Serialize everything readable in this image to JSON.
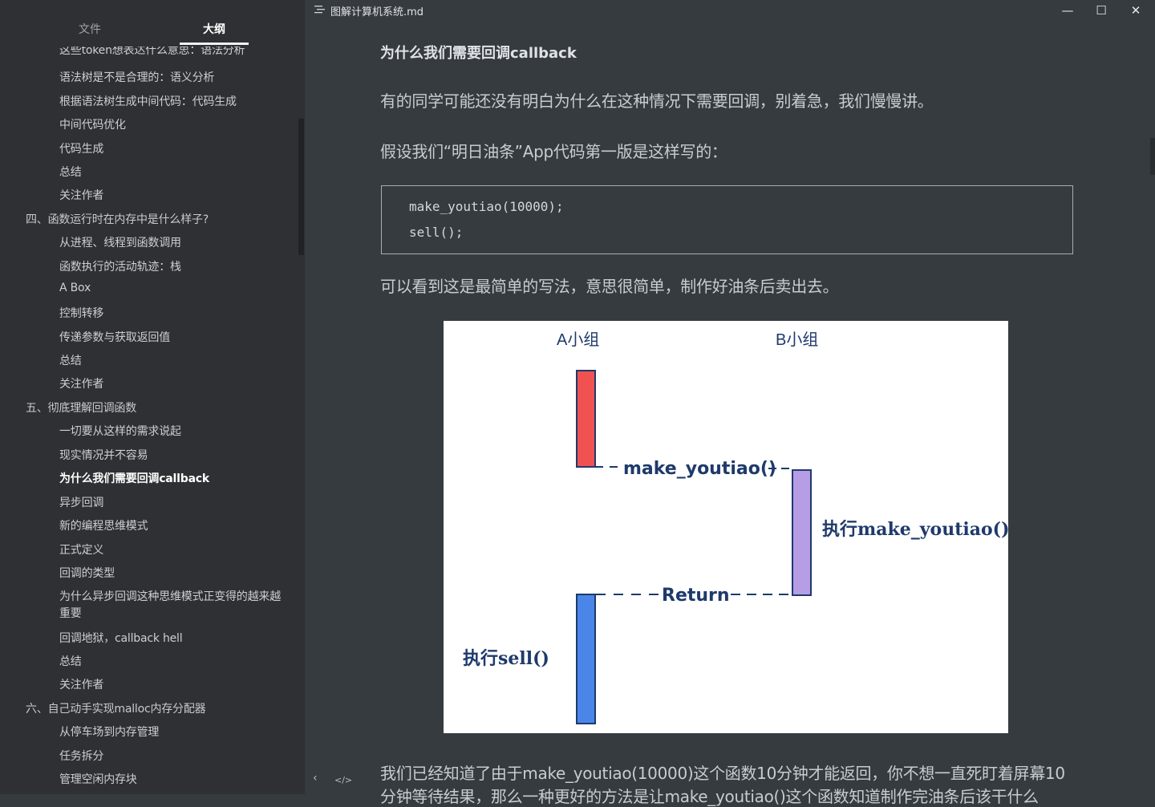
{
  "sidebar": {
    "tabs": {
      "files": "文件",
      "outline": "大纲"
    },
    "items": [
      {
        "label": "这些token想表达什么意思：语法分析",
        "level": 2
      },
      {
        "label": "语法树是不是合理的：语义分析",
        "level": 2
      },
      {
        "label": "根据语法树生成中间代码：代码生成",
        "level": 2
      },
      {
        "label": "中间代码优化",
        "level": 2
      },
      {
        "label": "代码生成",
        "level": 2
      },
      {
        "label": "总结",
        "level": 2
      },
      {
        "label": "关注作者",
        "level": 2
      },
      {
        "label": "四、函数运行时在内存中是什么样子?",
        "level": 1
      },
      {
        "label": "从进程、线程到函数调用",
        "level": 2
      },
      {
        "label": "函数执行的活动轨迹：栈",
        "level": 2
      },
      {
        "label": "A Box",
        "level": 2
      },
      {
        "label": "控制转移",
        "level": 2
      },
      {
        "label": "传递参数与获取返回值",
        "level": 2
      },
      {
        "label": "总结",
        "level": 2
      },
      {
        "label": "关注作者",
        "level": 2
      },
      {
        "label": "五、彻底理解回调函数",
        "level": 1
      },
      {
        "label": "一切要从这样的需求说起",
        "level": 2
      },
      {
        "label": "现实情况并不容易",
        "level": 2
      },
      {
        "label": "为什么我们需要回调callback",
        "level": 2,
        "active": true
      },
      {
        "label": "异步回调",
        "level": 2
      },
      {
        "label": "新的编程思维模式",
        "level": 2
      },
      {
        "label": "正式定义",
        "level": 2
      },
      {
        "label": "回调的类型",
        "level": 2
      },
      {
        "label": "为什么异步回调这种思维模式正变得的越来越重要",
        "level": 2,
        "wrap": true
      },
      {
        "label": "回调地狱，callback hell",
        "level": 2
      },
      {
        "label": "总结",
        "level": 2
      },
      {
        "label": "关注作者",
        "level": 2
      },
      {
        "label": "六、自己动手实现malloc内存分配器",
        "level": 1
      },
      {
        "label": "从停车场到内存管理",
        "level": 2
      },
      {
        "label": "任务拆分",
        "level": 2
      },
      {
        "label": "管理空闲内存块",
        "level": 2
      }
    ]
  },
  "titlebar": {
    "filename": "图解计算机系统.md",
    "minimize": "—",
    "maximize": "☐",
    "close": "✕"
  },
  "content": {
    "heading": "为什么我们需要回调callback",
    "p1": "有的同学可能还没有明白为什么在这种情况下需要回调，别着急，我们慢慢讲。",
    "p2": "假设我们“明日油条”App代码第一版是这样写的：",
    "code": [
      "make_youtiao(10000);",
      "sell();"
    ],
    "p3": "可以看到这是最简单的写法，意思很简单，制作好油条后卖出去。",
    "p4": "我们已经知道了由于make_youtiao(10000)这个函数10分钟才能返回，你不想一直死盯着屏幕10",
    "p5": "分钟等待结果，那么一种更好的方法是让make_youtiao()这个函数知道制作完油条后该干什么"
  },
  "diagram": {
    "group_a": "A小组",
    "group_b": "B小组",
    "call_label": "make_youtiao()",
    "exec_b": "执行make_youtiao()",
    "return_label": "Return",
    "exec_a": "执行sell()",
    "colors": {
      "red": "#f05252",
      "purple": "#b79ce6",
      "blue": "#4a86e8",
      "ink": "#1e3a6b"
    }
  },
  "bottom": {
    "back_icon": "‹",
    "source_icon": "</>"
  }
}
